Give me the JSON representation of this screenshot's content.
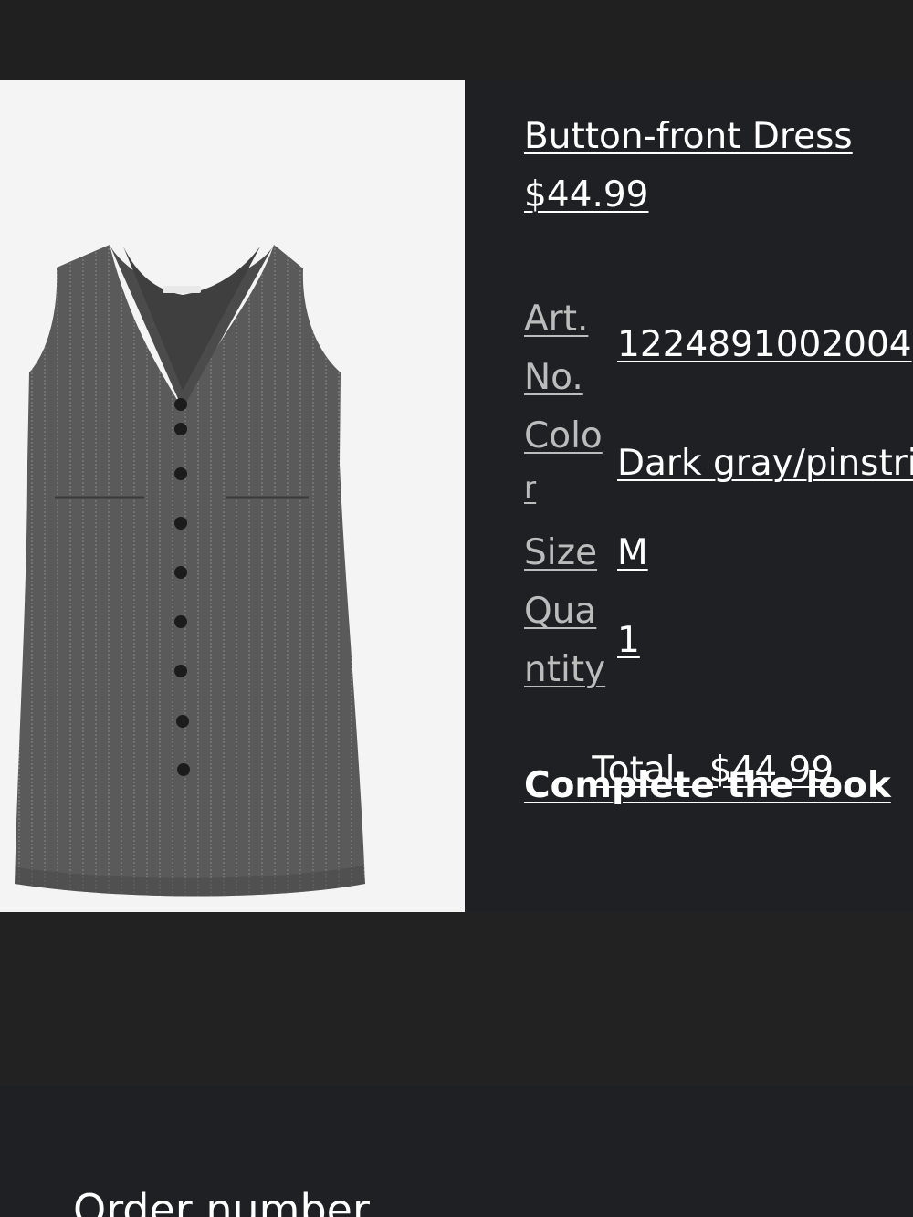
{
  "product": {
    "title": "Button-front Dress",
    "price": "$44.99",
    "image_alt": "Dark gray pinstriped sleeveless button-front dress"
  },
  "details": {
    "art_no_label_1": "Art.",
    "art_no_label_2": "No.",
    "art_no_value": "1224891002004",
    "color_label_1": "Colo",
    "color_label_2": "r",
    "color_value": "Dark gray/pinstriped",
    "size_label": "Size",
    "size_value": "M",
    "quantity_label_1": "Qua",
    "quantity_label_2": "ntity",
    "quantity_value": "1",
    "total_label": "Total",
    "total_value": "$44.99"
  },
  "complete_the_look": "Complete the look",
  "order": {
    "label": "Order number"
  }
}
